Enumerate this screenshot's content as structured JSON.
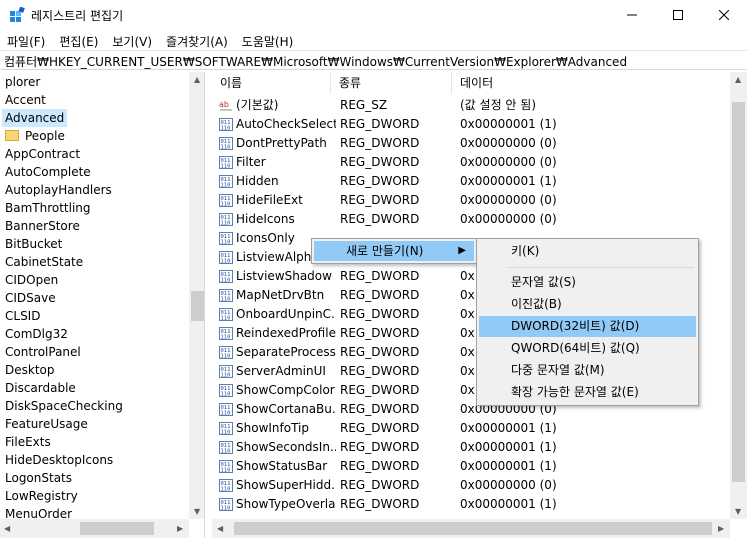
{
  "window": {
    "title": "레지스트리 편집기"
  },
  "menubar": [
    "파일(F)",
    "편집(E)",
    "보기(V)",
    "즐겨찾기(A)",
    "도움말(H)"
  ],
  "address": "컴퓨터₩HKEY_CURRENT_USER₩SOFTWARE₩Microsoft₩Windows₩CurrentVersion₩Explorer₩Advanced",
  "tree": {
    "items": [
      {
        "label": "plorer"
      },
      {
        "label": "Accent"
      },
      {
        "label": "Advanced",
        "selected": true
      },
      {
        "label": "People",
        "folder": true
      },
      {
        "label": "AppContract"
      },
      {
        "label": "AutoComplete"
      },
      {
        "label": "AutoplayHandlers"
      },
      {
        "label": "BamThrottling"
      },
      {
        "label": "BannerStore"
      },
      {
        "label": "BitBucket"
      },
      {
        "label": "CabinetState"
      },
      {
        "label": "CIDOpen"
      },
      {
        "label": "CIDSave"
      },
      {
        "label": "CLSID"
      },
      {
        "label": "ComDlg32"
      },
      {
        "label": "ControlPanel"
      },
      {
        "label": "Desktop"
      },
      {
        "label": "Discardable"
      },
      {
        "label": "DiskSpaceChecking"
      },
      {
        "label": "FeatureUsage"
      },
      {
        "label": "FileExts"
      },
      {
        "label": "HideDesktopIcons"
      },
      {
        "label": "LogonStats"
      },
      {
        "label": "LowRegistry"
      },
      {
        "label": "MenuOrder"
      }
    ]
  },
  "columns": {
    "name": "이름",
    "type": "종류",
    "data": "데이터"
  },
  "values": [
    {
      "name": "(기본값)",
      "type": "REG_SZ",
      "data": "(값 설정 안 됨)",
      "icon": "string"
    },
    {
      "name": "AutoCheckSelect",
      "type": "REG_DWORD",
      "data": "0x00000001 (1)",
      "icon": "dword"
    },
    {
      "name": "DontPrettyPath",
      "type": "REG_DWORD",
      "data": "0x00000000 (0)",
      "icon": "dword"
    },
    {
      "name": "Filter",
      "type": "REG_DWORD",
      "data": "0x00000000 (0)",
      "icon": "dword"
    },
    {
      "name": "Hidden",
      "type": "REG_DWORD",
      "data": "0x00000001 (1)",
      "icon": "dword"
    },
    {
      "name": "HideFileExt",
      "type": "REG_DWORD",
      "data": "0x00000000 (0)",
      "icon": "dword"
    },
    {
      "name": "HideIcons",
      "type": "REG_DWORD",
      "data": "0x00000000 (0)",
      "icon": "dword"
    },
    {
      "name": "IconsOnly",
      "type": "",
      "data": "",
      "icon": "dword"
    },
    {
      "name": "ListviewAlpha",
      "type": "",
      "data": "",
      "icon": "dword"
    },
    {
      "name": "ListviewShadow",
      "type": "REG_DWORD",
      "data": "0x",
      "icon": "dword"
    },
    {
      "name": "MapNetDrvBtn",
      "type": "REG_DWORD",
      "data": "0x",
      "icon": "dword"
    },
    {
      "name": "OnboardUnpinC...",
      "type": "REG_DWORD",
      "data": "0x",
      "icon": "dword"
    },
    {
      "name": "ReindexedProfile",
      "type": "REG_DWORD",
      "data": "0x",
      "icon": "dword"
    },
    {
      "name": "SeparateProcess",
      "type": "REG_DWORD",
      "data": "0x",
      "icon": "dword"
    },
    {
      "name": "ServerAdminUI",
      "type": "REG_DWORD",
      "data": "0x",
      "icon": "dword"
    },
    {
      "name": "ShowCompColor",
      "type": "REG_DWORD",
      "data": "0x",
      "icon": "dword"
    },
    {
      "name": "ShowCortanaBu...",
      "type": "REG_DWORD",
      "data": "0x00000000 (0)",
      "icon": "dword"
    },
    {
      "name": "ShowInfoTip",
      "type": "REG_DWORD",
      "data": "0x00000001 (1)",
      "icon": "dword"
    },
    {
      "name": "ShowSecondsIn...",
      "type": "REG_DWORD",
      "data": "0x00000001 (1)",
      "icon": "dword"
    },
    {
      "name": "ShowStatusBar",
      "type": "REG_DWORD",
      "data": "0x00000001 (1)",
      "icon": "dword"
    },
    {
      "name": "ShowSuperHidd...",
      "type": "REG_DWORD",
      "data": "0x00000000 (0)",
      "icon": "dword"
    },
    {
      "name": "ShowTypeOverlay",
      "type": "REG_DWORD",
      "data": "0x00000001 (1)",
      "icon": "dword"
    }
  ],
  "context_menu": {
    "label": "새로 만들기(N)"
  },
  "submenu": {
    "items": [
      {
        "label": "키(K)"
      },
      {
        "separator": true
      },
      {
        "label": "문자열 값(S)"
      },
      {
        "label": "이진값(B)"
      },
      {
        "label": "DWORD(32비트) 값(D)",
        "highlighted": true
      },
      {
        "label": "QWORD(64비트) 값(Q)"
      },
      {
        "label": "다중 문자열 값(M)"
      },
      {
        "label": "확장 가능한 문자열 값(E)"
      }
    ]
  },
  "colors": {
    "selection": "#cce8ff",
    "menu_highlight": "#91c9f7",
    "scrollbar": "#f0f0f0"
  }
}
